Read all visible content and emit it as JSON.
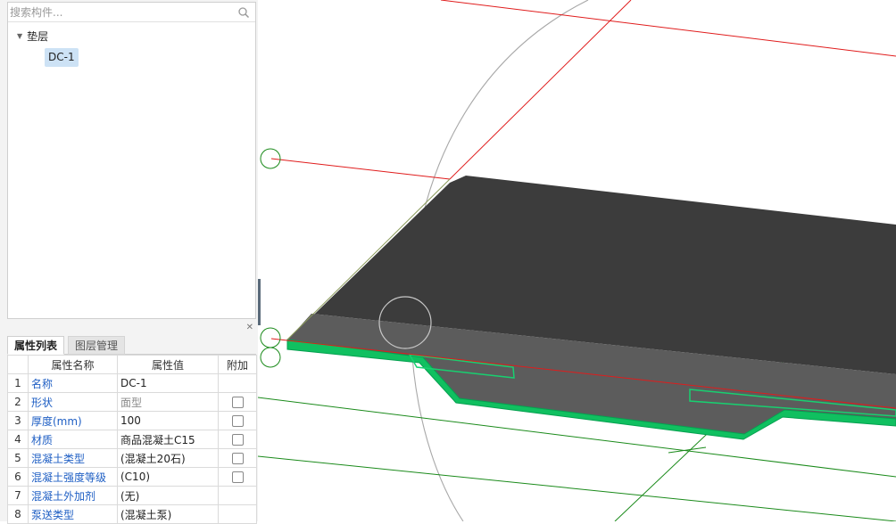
{
  "tree": {
    "search_placeholder": "搜索构件...",
    "root_label": "垫层",
    "child_label": "DC-1"
  },
  "panel": {
    "close_glyph": "✕",
    "tabs": [
      {
        "label": "属性列表",
        "active": true
      },
      {
        "label": "图层管理",
        "active": false
      }
    ]
  },
  "properties": {
    "headers": [
      "",
      "属性名称",
      "属性值",
      "附加"
    ],
    "rows": [
      {
        "num": "1",
        "name": "名称",
        "value": "DC-1",
        "checkbox": false,
        "dim": false
      },
      {
        "num": "2",
        "name": "形状",
        "value": "面型",
        "checkbox": true,
        "dim": true
      },
      {
        "num": "3",
        "name": "厚度(mm)",
        "value": "100",
        "checkbox": true,
        "dim": false
      },
      {
        "num": "4",
        "name": "材质",
        "value": "商品混凝土C15",
        "checkbox": true,
        "dim": false
      },
      {
        "num": "5",
        "name": "混凝土类型",
        "value": "(混凝土20石)",
        "checkbox": true,
        "dim": false
      },
      {
        "num": "6",
        "name": "混凝土强度等级",
        "value": "(C10)",
        "checkbox": true,
        "dim": false
      },
      {
        "num": "7",
        "name": "混凝土外加剂",
        "value": "(无)",
        "checkbox": false,
        "dim": false
      },
      {
        "num": "8",
        "name": "泵送类型",
        "value": "(混凝土泵)",
        "checkbox": false,
        "dim": false
      }
    ]
  },
  "colors": {
    "slab_top": "#3c3c3c",
    "slab_front": "#5c5c5c",
    "highlight_green": "#10c060",
    "axis_red": "#e01c1c",
    "grid_green": "#1a8a1a",
    "guide_gray": "#a8a8a8"
  }
}
